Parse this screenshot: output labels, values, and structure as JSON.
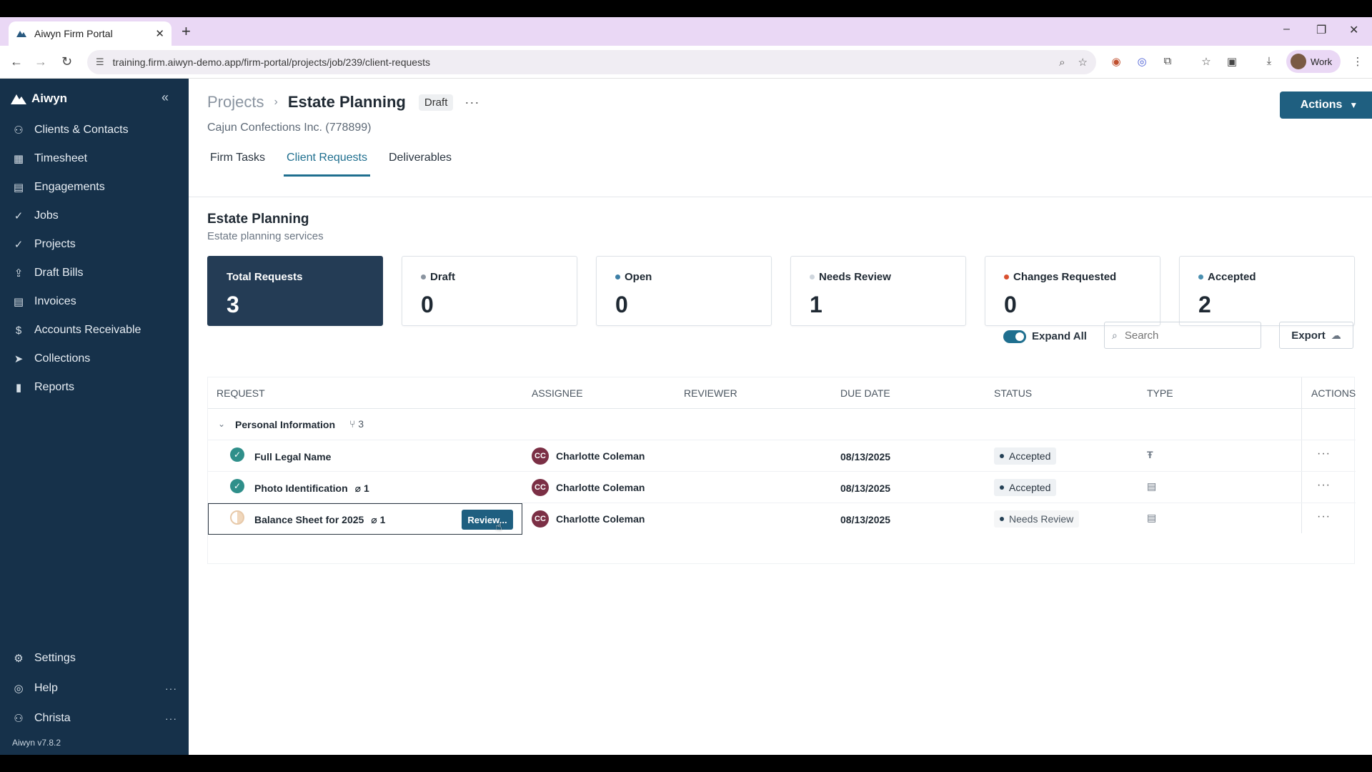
{
  "browser": {
    "tab_title": "Aiwyn Firm Portal",
    "url": "training.firm.aiwyn-demo.app/firm-portal/projects/job/239/client-requests",
    "profile_label": "Work"
  },
  "sidebar": {
    "brand": "Aiwyn",
    "items": [
      {
        "label": "Clients & Contacts",
        "icon": "users-icon"
      },
      {
        "label": "Timesheet",
        "icon": "calendar-icon"
      },
      {
        "label": "Engagements",
        "icon": "document-icon"
      },
      {
        "label": "Jobs",
        "icon": "check-circle-icon"
      },
      {
        "label": "Projects",
        "icon": "check-circle-icon"
      },
      {
        "label": "Draft Bills",
        "icon": "upload-icon"
      },
      {
        "label": "Invoices",
        "icon": "document-icon"
      },
      {
        "label": "Accounts Receivable",
        "icon": "dollar-icon"
      },
      {
        "label": "Collections",
        "icon": "send-icon"
      },
      {
        "label": "Reports",
        "icon": "bar-chart-icon"
      }
    ],
    "settings": "Settings",
    "help": "Help",
    "user": "Christa",
    "version": "Aiwyn v7.8.2"
  },
  "header": {
    "breadcrumb_root": "Projects",
    "breadcrumb_current": "Estate Planning",
    "status_badge": "Draft",
    "client": "Cajun Confections Inc. (778899)",
    "actions_label": "Actions"
  },
  "tabs": [
    {
      "label": "Firm Tasks",
      "active": false
    },
    {
      "label": "Client Requests",
      "active": true
    },
    {
      "label": "Deliverables",
      "active": false
    }
  ],
  "section": {
    "title": "Estate Planning",
    "subtitle": "Estate planning services"
  },
  "cards": [
    {
      "label": "Total Requests",
      "value": "3",
      "dot": null
    },
    {
      "label": "Draft",
      "value": "0",
      "dot": "#8a94a0"
    },
    {
      "label": "Open",
      "value": "0",
      "dot": "#3d7fa6"
    },
    {
      "label": "Needs Review",
      "value": "1",
      "dot": "#cfd6dd"
    },
    {
      "label": "Changes Requested",
      "value": "0",
      "dot": "#d9502f"
    },
    {
      "label": "Accepted",
      "value": "2",
      "dot": "#4a8fb0"
    }
  ],
  "controls": {
    "expand_all": "Expand All",
    "search_placeholder": "Search",
    "export": "Export"
  },
  "table": {
    "headers": [
      "Request",
      "Assignee",
      "Reviewer",
      "Due Date",
      "Status",
      "Type",
      "Actions"
    ],
    "group": {
      "name": "Personal Information",
      "count": "3"
    },
    "rows": [
      {
        "name": "Full Legal Name",
        "attachments": "",
        "assignee_initials": "CC",
        "assignee": "Charlotte Coleman",
        "due": "08/13/2025",
        "status": "Accepted",
        "type_icon": "text-icon"
      },
      {
        "name": "Photo Identification",
        "attachments": "1",
        "assignee_initials": "CC",
        "assignee": "Charlotte Coleman",
        "due": "08/13/2025",
        "status": "Accepted",
        "type_icon": "file-icon"
      },
      {
        "name": "Balance Sheet for 2025",
        "attachments": "1",
        "assignee_initials": "CC",
        "assignee": "Charlotte Coleman",
        "due": "08/13/2025",
        "status": "Needs Review",
        "type_icon": "file-icon",
        "review_button": "Review..."
      }
    ]
  }
}
